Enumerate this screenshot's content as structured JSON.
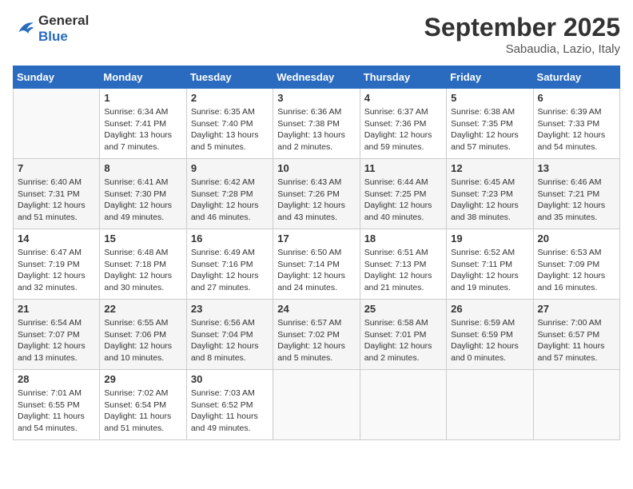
{
  "header": {
    "logo_general": "General",
    "logo_blue": "Blue",
    "month_title": "September 2025",
    "location": "Sabaudia, Lazio, Italy"
  },
  "weekdays": [
    "Sunday",
    "Monday",
    "Tuesday",
    "Wednesday",
    "Thursday",
    "Friday",
    "Saturday"
  ],
  "weeks": [
    [
      {
        "day": "",
        "sunrise": "",
        "sunset": "",
        "daylight": ""
      },
      {
        "day": "1",
        "sunrise": "Sunrise: 6:34 AM",
        "sunset": "Sunset: 7:41 PM",
        "daylight": "Daylight: 13 hours and 7 minutes."
      },
      {
        "day": "2",
        "sunrise": "Sunrise: 6:35 AM",
        "sunset": "Sunset: 7:40 PM",
        "daylight": "Daylight: 13 hours and 5 minutes."
      },
      {
        "day": "3",
        "sunrise": "Sunrise: 6:36 AM",
        "sunset": "Sunset: 7:38 PM",
        "daylight": "Daylight: 13 hours and 2 minutes."
      },
      {
        "day": "4",
        "sunrise": "Sunrise: 6:37 AM",
        "sunset": "Sunset: 7:36 PM",
        "daylight": "Daylight: 12 hours and 59 minutes."
      },
      {
        "day": "5",
        "sunrise": "Sunrise: 6:38 AM",
        "sunset": "Sunset: 7:35 PM",
        "daylight": "Daylight: 12 hours and 57 minutes."
      },
      {
        "day": "6",
        "sunrise": "Sunrise: 6:39 AM",
        "sunset": "Sunset: 7:33 PM",
        "daylight": "Daylight: 12 hours and 54 minutes."
      }
    ],
    [
      {
        "day": "7",
        "sunrise": "Sunrise: 6:40 AM",
        "sunset": "Sunset: 7:31 PM",
        "daylight": "Daylight: 12 hours and 51 minutes."
      },
      {
        "day": "8",
        "sunrise": "Sunrise: 6:41 AM",
        "sunset": "Sunset: 7:30 PM",
        "daylight": "Daylight: 12 hours and 49 minutes."
      },
      {
        "day": "9",
        "sunrise": "Sunrise: 6:42 AM",
        "sunset": "Sunset: 7:28 PM",
        "daylight": "Daylight: 12 hours and 46 minutes."
      },
      {
        "day": "10",
        "sunrise": "Sunrise: 6:43 AM",
        "sunset": "Sunset: 7:26 PM",
        "daylight": "Daylight: 12 hours and 43 minutes."
      },
      {
        "day": "11",
        "sunrise": "Sunrise: 6:44 AM",
        "sunset": "Sunset: 7:25 PM",
        "daylight": "Daylight: 12 hours and 40 minutes."
      },
      {
        "day": "12",
        "sunrise": "Sunrise: 6:45 AM",
        "sunset": "Sunset: 7:23 PM",
        "daylight": "Daylight: 12 hours and 38 minutes."
      },
      {
        "day": "13",
        "sunrise": "Sunrise: 6:46 AM",
        "sunset": "Sunset: 7:21 PM",
        "daylight": "Daylight: 12 hours and 35 minutes."
      }
    ],
    [
      {
        "day": "14",
        "sunrise": "Sunrise: 6:47 AM",
        "sunset": "Sunset: 7:19 PM",
        "daylight": "Daylight: 12 hours and 32 minutes."
      },
      {
        "day": "15",
        "sunrise": "Sunrise: 6:48 AM",
        "sunset": "Sunset: 7:18 PM",
        "daylight": "Daylight: 12 hours and 30 minutes."
      },
      {
        "day": "16",
        "sunrise": "Sunrise: 6:49 AM",
        "sunset": "Sunset: 7:16 PM",
        "daylight": "Daylight: 12 hours and 27 minutes."
      },
      {
        "day": "17",
        "sunrise": "Sunrise: 6:50 AM",
        "sunset": "Sunset: 7:14 PM",
        "daylight": "Daylight: 12 hours and 24 minutes."
      },
      {
        "day": "18",
        "sunrise": "Sunrise: 6:51 AM",
        "sunset": "Sunset: 7:13 PM",
        "daylight": "Daylight: 12 hours and 21 minutes."
      },
      {
        "day": "19",
        "sunrise": "Sunrise: 6:52 AM",
        "sunset": "Sunset: 7:11 PM",
        "daylight": "Daylight: 12 hours and 19 minutes."
      },
      {
        "day": "20",
        "sunrise": "Sunrise: 6:53 AM",
        "sunset": "Sunset: 7:09 PM",
        "daylight": "Daylight: 12 hours and 16 minutes."
      }
    ],
    [
      {
        "day": "21",
        "sunrise": "Sunrise: 6:54 AM",
        "sunset": "Sunset: 7:07 PM",
        "daylight": "Daylight: 12 hours and 13 minutes."
      },
      {
        "day": "22",
        "sunrise": "Sunrise: 6:55 AM",
        "sunset": "Sunset: 7:06 PM",
        "daylight": "Daylight: 12 hours and 10 minutes."
      },
      {
        "day": "23",
        "sunrise": "Sunrise: 6:56 AM",
        "sunset": "Sunset: 7:04 PM",
        "daylight": "Daylight: 12 hours and 8 minutes."
      },
      {
        "day": "24",
        "sunrise": "Sunrise: 6:57 AM",
        "sunset": "Sunset: 7:02 PM",
        "daylight": "Daylight: 12 hours and 5 minutes."
      },
      {
        "day": "25",
        "sunrise": "Sunrise: 6:58 AM",
        "sunset": "Sunset: 7:01 PM",
        "daylight": "Daylight: 12 hours and 2 minutes."
      },
      {
        "day": "26",
        "sunrise": "Sunrise: 6:59 AM",
        "sunset": "Sunset: 6:59 PM",
        "daylight": "Daylight: 12 hours and 0 minutes."
      },
      {
        "day": "27",
        "sunrise": "Sunrise: 7:00 AM",
        "sunset": "Sunset: 6:57 PM",
        "daylight": "Daylight: 11 hours and 57 minutes."
      }
    ],
    [
      {
        "day": "28",
        "sunrise": "Sunrise: 7:01 AM",
        "sunset": "Sunset: 6:55 PM",
        "daylight": "Daylight: 11 hours and 54 minutes."
      },
      {
        "day": "29",
        "sunrise": "Sunrise: 7:02 AM",
        "sunset": "Sunset: 6:54 PM",
        "daylight": "Daylight: 11 hours and 51 minutes."
      },
      {
        "day": "30",
        "sunrise": "Sunrise: 7:03 AM",
        "sunset": "Sunset: 6:52 PM",
        "daylight": "Daylight: 11 hours and 49 minutes."
      },
      {
        "day": "",
        "sunrise": "",
        "sunset": "",
        "daylight": ""
      },
      {
        "day": "",
        "sunrise": "",
        "sunset": "",
        "daylight": ""
      },
      {
        "day": "",
        "sunrise": "",
        "sunset": "",
        "daylight": ""
      },
      {
        "day": "",
        "sunrise": "",
        "sunset": "",
        "daylight": ""
      }
    ]
  ]
}
